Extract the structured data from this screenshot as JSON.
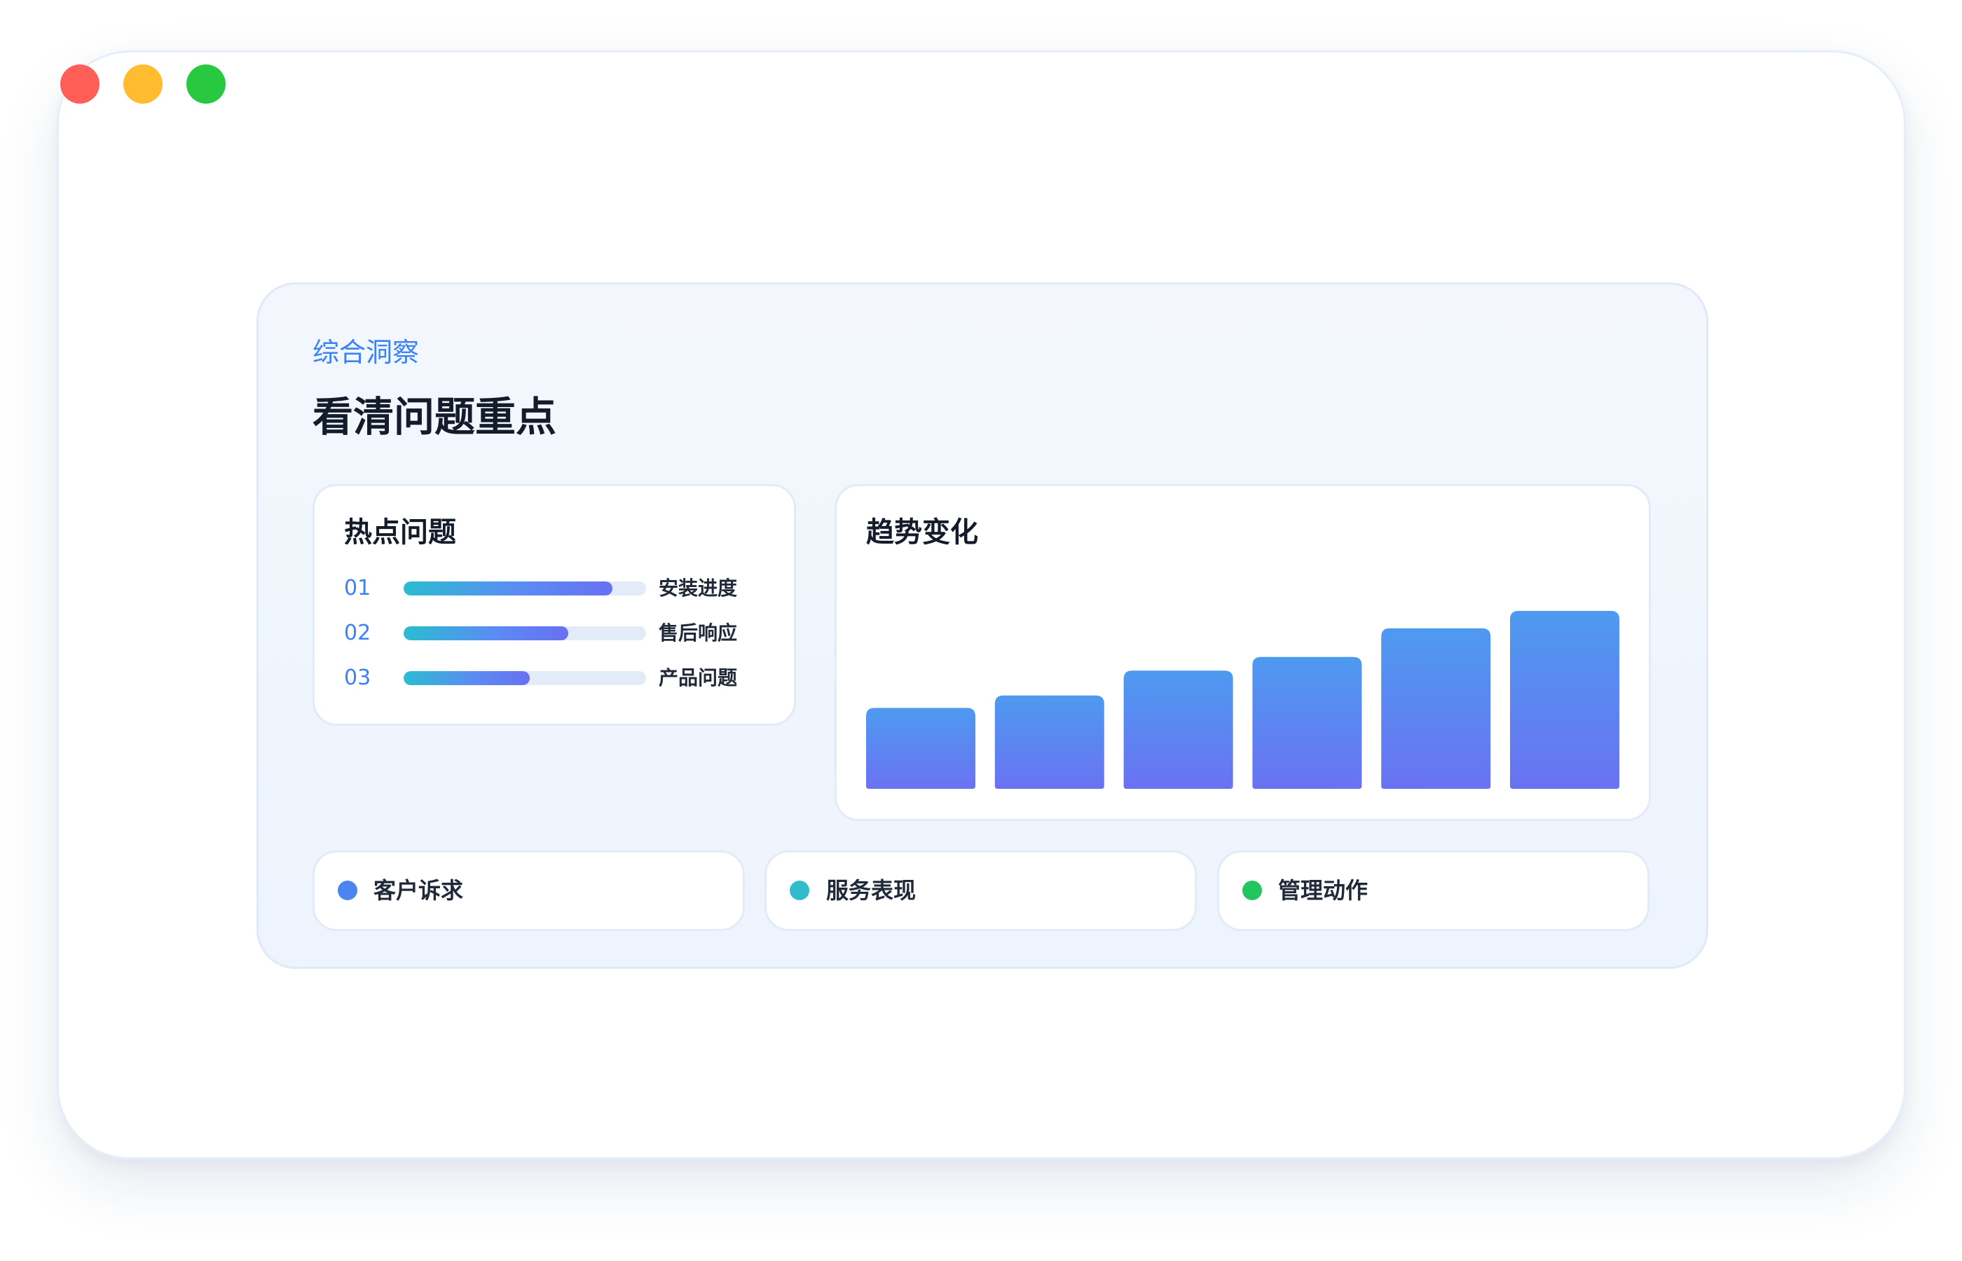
{
  "colors": {
    "close": "#ff5f57",
    "minimize": "#febc2e",
    "maximize": "#28c840",
    "accent": "#3b82f6",
    "bar_top": "#4e9af0",
    "bar_bottom": "#6a72f2"
  },
  "insight": {
    "eyebrow": "综合洞察",
    "headline": "看清问题重点"
  },
  "hot_issues": {
    "title": "热点问题",
    "items": [
      {
        "rank": "01",
        "label": "安装进度",
        "progress": 0.86
      },
      {
        "rank": "02",
        "label": "售后响应",
        "progress": 0.68
      },
      {
        "rank": "03",
        "label": "产品问题",
        "progress": 0.52
      }
    ]
  },
  "trend": {
    "title": "趋势变化"
  },
  "chart_data": {
    "type": "bar",
    "title": "趋势变化",
    "categories": [],
    "values": [
      65,
      75,
      95,
      106,
      129,
      143
    ],
    "ylim": [
      0,
      143
    ],
    "grid": false,
    "legend": "none"
  },
  "tags": [
    {
      "label": "客户诉求",
      "dot_color": "#4b86f0"
    },
    {
      "label": "服务表现",
      "dot_color": "#2fbccc"
    },
    {
      "label": "管理动作",
      "dot_color": "#22c55e"
    }
  ]
}
